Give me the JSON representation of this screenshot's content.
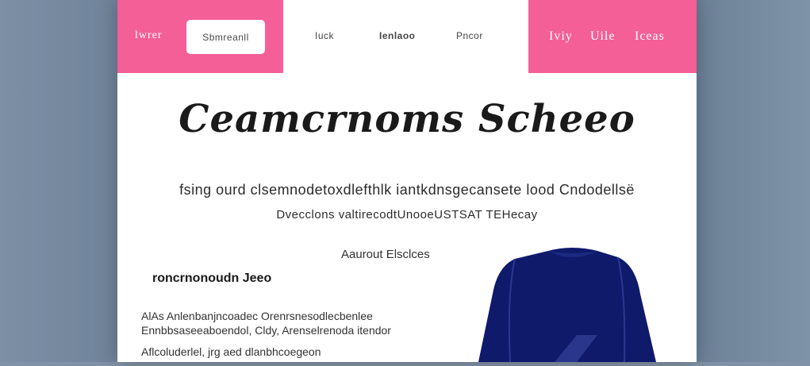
{
  "nav": {
    "left_link": "lwrer",
    "left_button": "Sbmreanll",
    "center_links": [
      "Iuck",
      "Ienlaoo",
      "Pncor"
    ],
    "right_links": [
      "Iviy",
      "Uile",
      "Iceas"
    ]
  },
  "hero": {
    "title": "Ceamcrnoms Scheeo",
    "subtitle_1": "fsing  ourd  clsemnodetoxdlefthlk  iantkdnsgecansete  lood  Cndodellsë",
    "subtitle_2": "Dvecclons  valtirecodtUnooeUSTSAT TEHecay"
  },
  "section": {
    "heading": "Aaurout Elsclces",
    "left_heading": "roncrnonoudn Jeeo",
    "lines": [
      "AlAs  Anlenbanjncoadec  Orenrsnesodlecbenlee",
      "Ennbbsaseeaboendol,  Cldy,  Arenselrenoda  itendor",
      "Aflcoluderlel,  jrg  aed  dlanbhcoegeon"
    ]
  },
  "colors": {
    "accent": "#f35f96",
    "product": "#0f1a6b"
  },
  "product_icon": "sweater-image"
}
